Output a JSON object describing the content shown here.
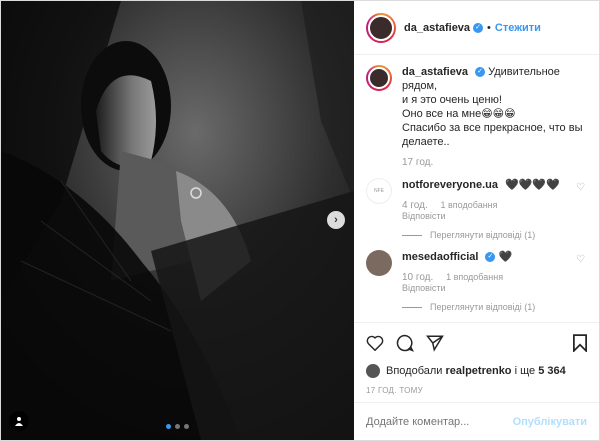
{
  "header": {
    "username": "da_astafieva",
    "follow_label": "Стежити"
  },
  "caption": {
    "username": "da_astafieva",
    "lines": [
      "Удивительное рядом,",
      "и я это очень ценю!",
      "Оно все на мне😁😁😁",
      "Спасибо за все прекрасное, что вы",
      "делаете.."
    ],
    "time": "17 год."
  },
  "comments": [
    {
      "username": "notforeveryone.ua",
      "text": "🖤🖤🖤🖤",
      "time": "4 год.",
      "likes": "1 вподобання",
      "reply_label": "Відповісти",
      "view_replies": "Переглянути відповіді (1)"
    },
    {
      "username": "mesedaofficial",
      "text": "🖤",
      "time": "10 год.",
      "likes": "1 вподобання",
      "reply_label": "Відповісти",
      "view_replies": "Переглянути відповіді (1)"
    }
  ],
  "likes": {
    "prefix": "Вподобали",
    "user": "realpetrenko",
    "middle": "і ще",
    "count": "5 364"
  },
  "timestamp": "17 ГОД. ТОМУ",
  "add_comment": {
    "placeholder": "Додайте коментар...",
    "publish_label": "Опублікувати"
  },
  "carousel": {
    "total": 3,
    "active": 1
  },
  "colors": {
    "accent": "#3897f0",
    "publish_disabled": "#b2dffc"
  },
  "icons": [
    "heart-icon",
    "comment-icon",
    "share-icon",
    "bookmark-icon",
    "user-tag-icon",
    "next-arrow-icon"
  ]
}
